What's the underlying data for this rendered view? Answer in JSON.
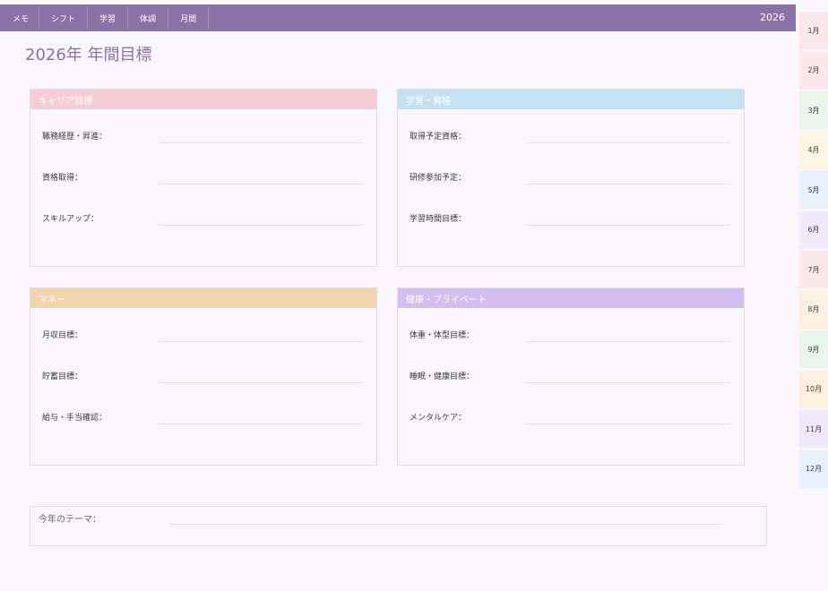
{
  "nav": {
    "tabs": [
      {
        "label": "メモ"
      },
      {
        "label": "シフト"
      },
      {
        "label": "学習"
      },
      {
        "label": "体調"
      },
      {
        "label": "月間"
      }
    ],
    "year": "2026"
  },
  "page": {
    "title": "2026年 年間目標"
  },
  "cards": [
    {
      "title": "キャリア目標",
      "color": "#f4cdd5",
      "rows": [
        {
          "label": "職務経歴・昇進："
        },
        {
          "label": "資格取得："
        },
        {
          "label": "スキルアップ："
        }
      ]
    },
    {
      "title": "学習・資格",
      "color": "#c4e2f1",
      "rows": [
        {
          "label": "取得予定資格："
        },
        {
          "label": "研修参加予定："
        },
        {
          "label": "学習時間目標："
        }
      ]
    },
    {
      "title": "マネー",
      "color": "#f3d5ad",
      "rows": [
        {
          "label": "月収目標："
        },
        {
          "label": "貯蓄目標："
        },
        {
          "label": "給与・手当確認："
        }
      ]
    },
    {
      "title": "健康・プライベート",
      "color": "#d2bff0",
      "rows": [
        {
          "label": "体重・体型目標："
        },
        {
          "label": "睡眠・健康目標："
        },
        {
          "label": "メンタルケア："
        }
      ]
    }
  ],
  "theme": {
    "label": "今年のテーマ："
  },
  "months": [
    {
      "label": "1月",
      "color": "#fbe8ec"
    },
    {
      "label": "2月",
      "color": "#fbe8ec"
    },
    {
      "label": "3月",
      "color": "#e8f6ec"
    },
    {
      "label": "4月",
      "color": "#fdf6e3"
    },
    {
      "label": "5月",
      "color": "#e8f1fb"
    },
    {
      "label": "6月",
      "color": "#f1eafa"
    },
    {
      "label": "7月",
      "color": "#fbe8ec"
    },
    {
      "label": "8月",
      "color": "#fdf1e3"
    },
    {
      "label": "9月",
      "color": "#e8f6ec"
    },
    {
      "label": "10月",
      "color": "#fdf1e3"
    },
    {
      "label": "11月",
      "color": "#efeafa"
    },
    {
      "label": "12月",
      "color": "#e8f0fb"
    }
  ]
}
